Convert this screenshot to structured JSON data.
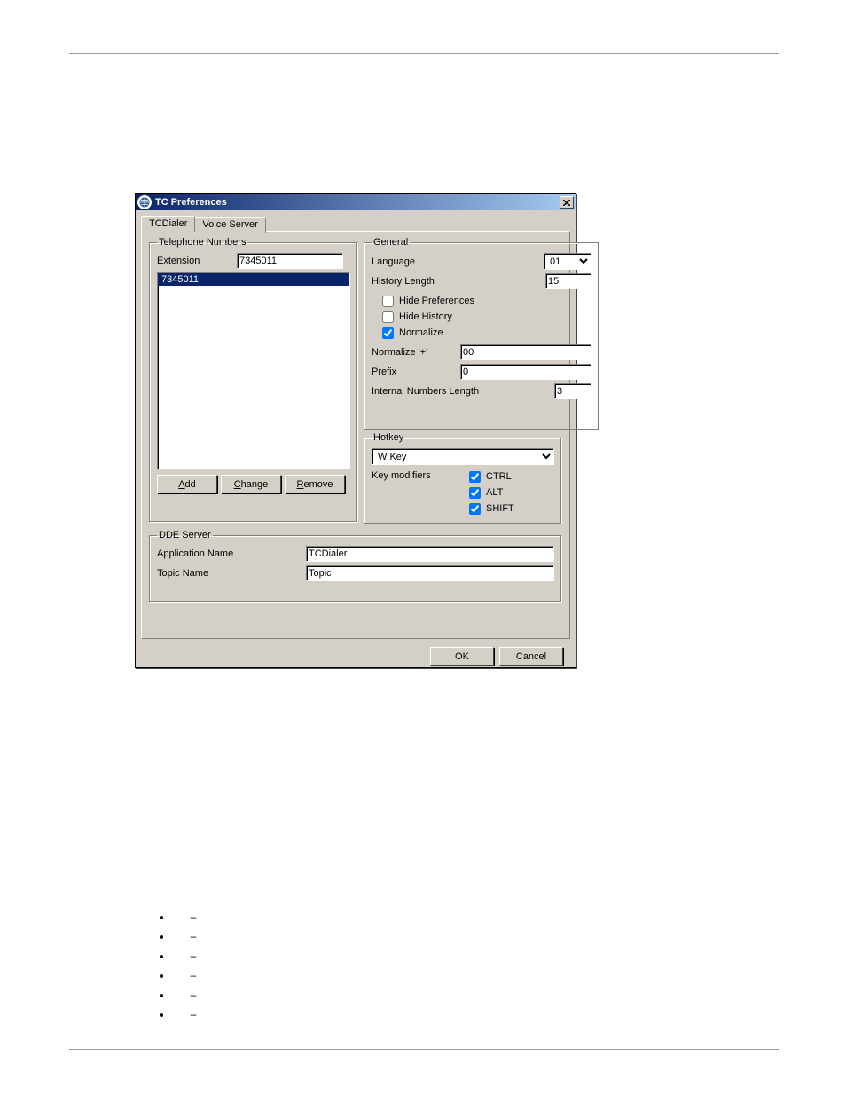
{
  "window": {
    "title": "TC Preferences",
    "close_tooltip": "Close"
  },
  "tabs": {
    "tcdialer": "TCDialer",
    "voiceserver": "Voice Server"
  },
  "telephone_numbers": {
    "legend": "Telephone Numbers",
    "extension_label": "Extension",
    "extension_value": "7345011",
    "list": [
      "7345011"
    ],
    "add_btn_pre": "",
    "add_btn_u": "A",
    "add_btn_post": "dd",
    "change_btn_pre": "",
    "change_btn_u": "C",
    "change_btn_post": "hange",
    "remove_btn_pre": "",
    "remove_btn_u": "R",
    "remove_btn_post": "emove"
  },
  "general": {
    "legend": "General",
    "language_label": "Language",
    "language_value": "01",
    "history_length_label": "History Length",
    "history_length_value": "15",
    "hide_preferences_label": "Hide Preferences",
    "hide_preferences_checked": false,
    "hide_history_label": "Hide History",
    "hide_history_checked": false,
    "normalize_label": "Normalize",
    "normalize_checked": true,
    "normalize_plus_label": "Normalize '+'",
    "normalize_plus_value": "00",
    "prefix_label": "Prefix",
    "prefix_value": "0",
    "internal_len_label": "Internal Numbers Length",
    "internal_len_value": "3"
  },
  "hotkey": {
    "legend": "Hotkey",
    "key_value": "W Key",
    "modifiers_label": "Key modifiers",
    "ctrl_label": "CTRL",
    "ctrl_checked": true,
    "alt_label": "ALT",
    "alt_checked": true,
    "shift_label": "SHIFT",
    "shift_checked": true
  },
  "dde": {
    "legend": "DDE Server",
    "app_name_label": "Application Name",
    "app_name_value": "TCDialer",
    "topic_label": "Topic Name",
    "topic_value": "Topic"
  },
  "buttons": {
    "ok": "OK",
    "cancel": "Cancel"
  },
  "bullets_dash": "–"
}
